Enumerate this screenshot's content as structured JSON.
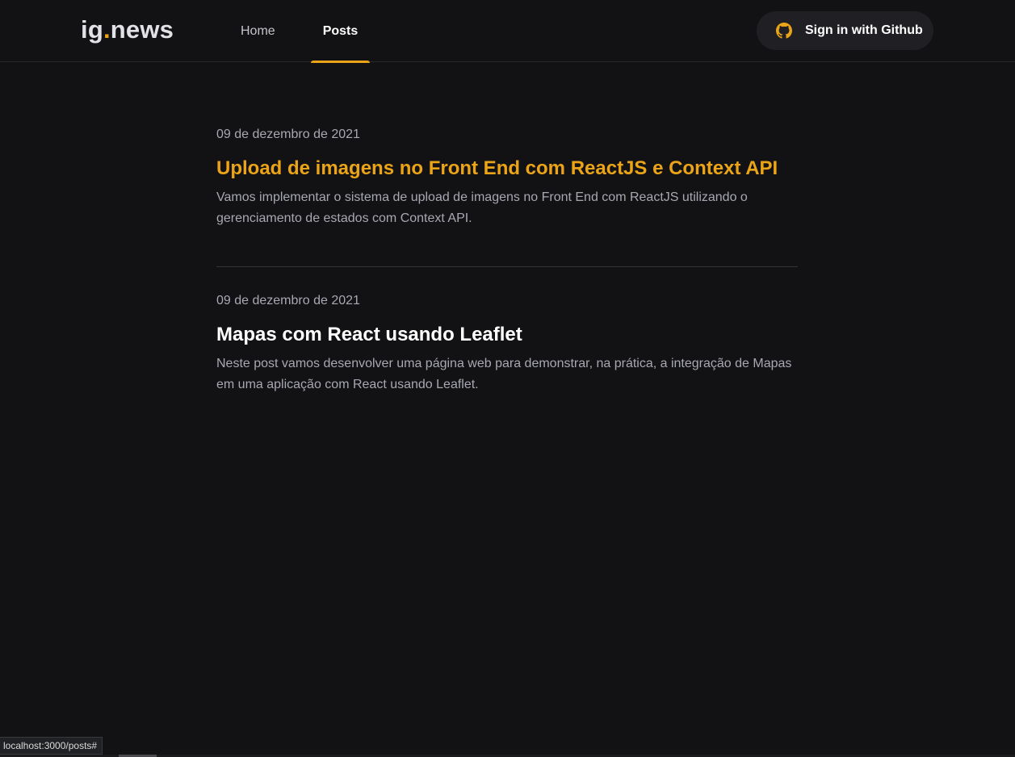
{
  "header": {
    "logo_main": "ig",
    "logo_dot": ".",
    "logo_tail": "news",
    "nav": [
      {
        "label": "Home",
        "active": false
      },
      {
        "label": "Posts",
        "active": true
      }
    ],
    "signin_label": "Sign in with Github",
    "signin_icon": "github-icon"
  },
  "posts": [
    {
      "date": "09 de dezembro de 2021",
      "title": "Upload de imagens no Front End com ReactJS e Context API",
      "excerpt": "Vamos implementar o sistema de upload de imagens no Front End com ReactJS utilizando o gerenciamento de estados com Context API."
    },
    {
      "date": "09 de dezembro de 2021",
      "title": "Mapas com React usando Leaflet",
      "excerpt": "Neste post vamos desenvolver uma página web para demonstrar, na prática, a integração de Mapas em uma aplicação com React usando Leaflet."
    }
  ],
  "status_url": "localhost:3000/posts#",
  "colors": {
    "accent": "#eba417",
    "background": "#121214",
    "button_bg": "#202024",
    "text_muted": "#a8a8b3"
  }
}
